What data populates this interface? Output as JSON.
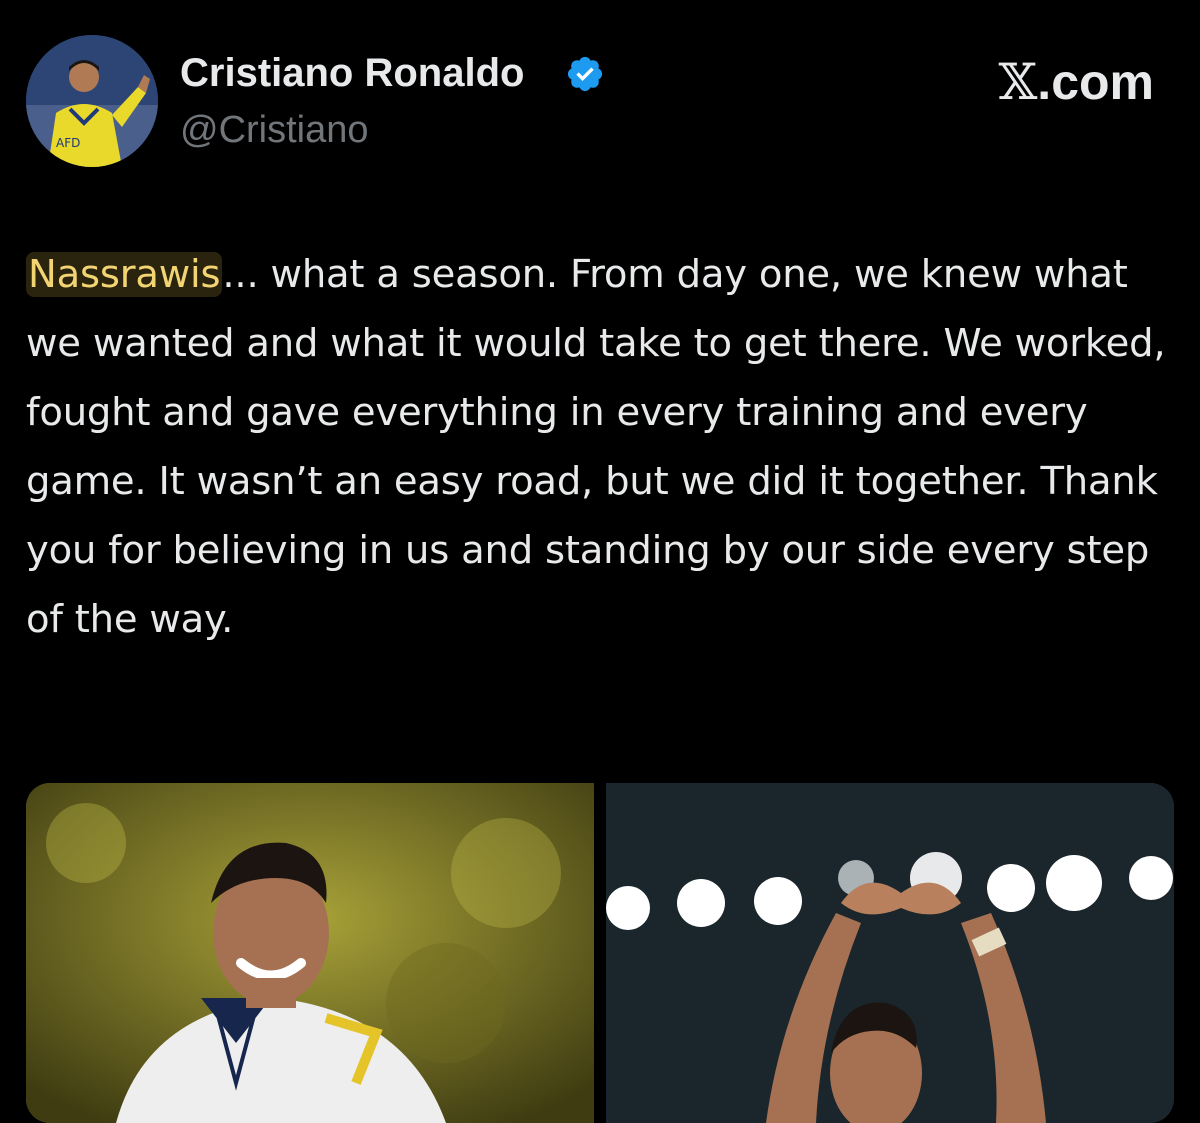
{
  "tweet": {
    "display_name": "Cristiano Ronaldo",
    "handle": "@Cristiano",
    "brand_x": "𝕏",
    "brand_suffix": ".com",
    "highlight_word": "Nassrawis",
    "body_text": "... what a season. From day one, we knew what we wanted and what it would take to get there. We worked, fought and gave everything in every training and every game. It wasn’t an easy road, but we did it together. Thank you for believing in us and standing by our side every step of the way."
  },
  "colors": {
    "background": "#000000",
    "text_primary": "#e7e9ea",
    "text_secondary": "#71767b",
    "verified_badge": "#1d9bf0",
    "highlight": "#f2d572"
  },
  "icons": {
    "verified": "verified-badge-icon"
  }
}
